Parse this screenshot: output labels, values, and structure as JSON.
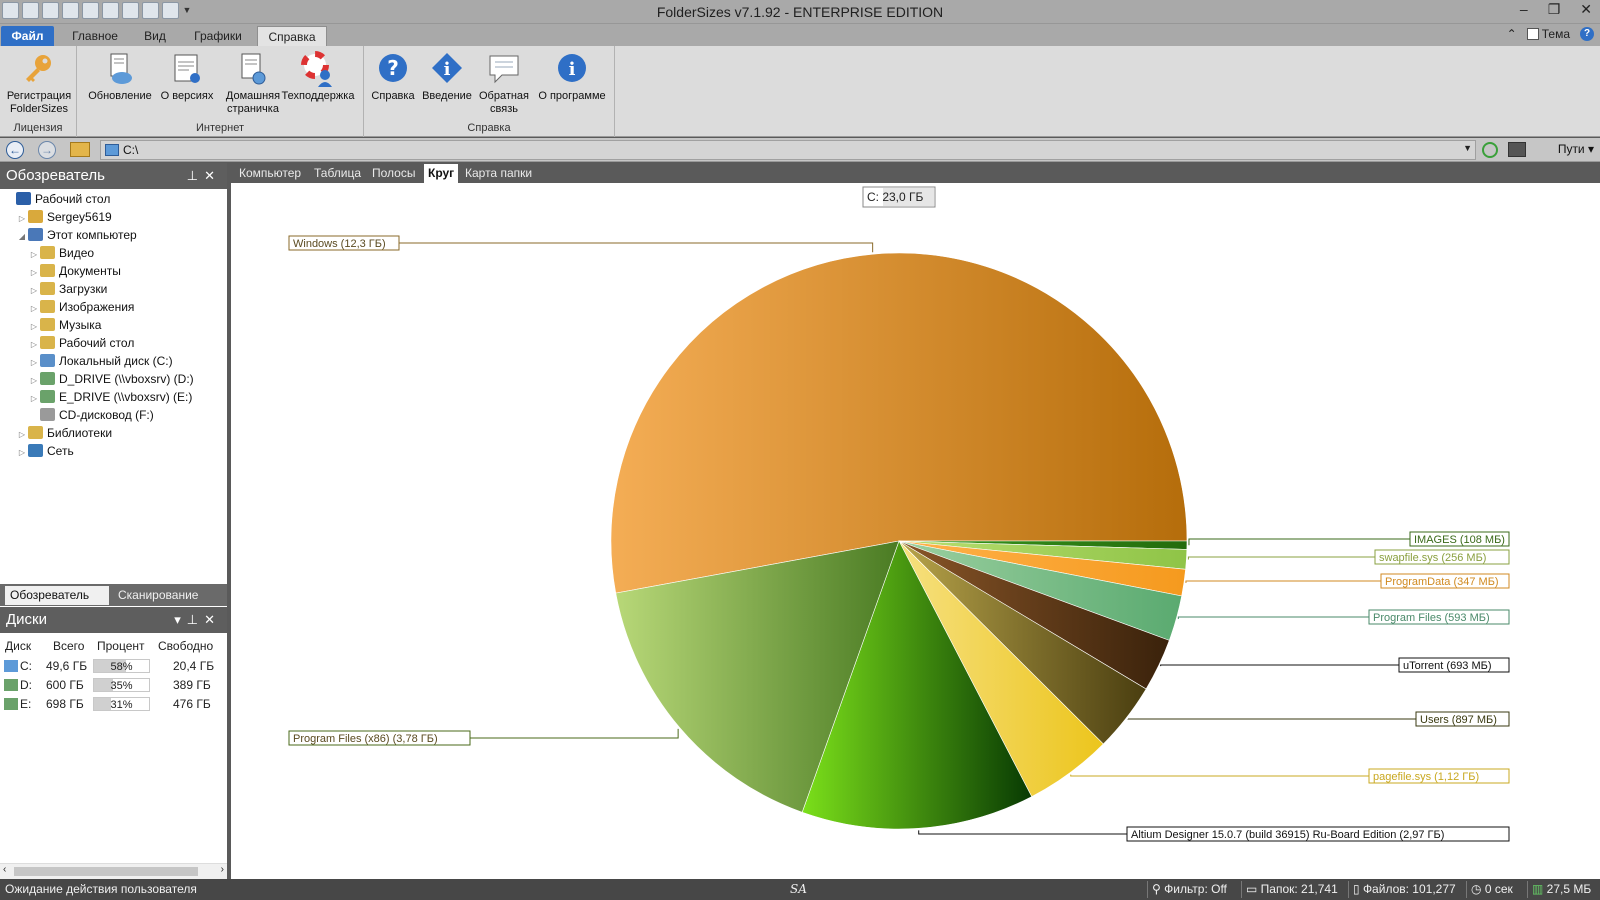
{
  "app_title": "FolderSizes v7.1.92 - ENTERPRISE EDITION",
  "quick_access_icons": [
    "new-icon",
    "open-icon",
    "save-icon",
    "search-icon",
    "refresh-icon",
    "folder-icon",
    "floppy-icon",
    "copy-icon",
    "print-icon"
  ],
  "window_controls": {
    "minimize": "–",
    "restore": "❐",
    "close": "✕"
  },
  "ribbon_tabs": {
    "file": "Файл",
    "main": "Главное",
    "view": "Вид",
    "graphs": "Графики",
    "help": "Справка"
  },
  "ribbon_right": {
    "theme": "Тема",
    "help": "?",
    "collapse": "⌃"
  },
  "ribbon": {
    "group_license": "Лицензия",
    "group_internet": "Интернет",
    "group_help": "Справка",
    "btn_register": "Регистрация FolderSizes",
    "btn_update": "Обновление",
    "btn_versions": "О версиях",
    "btn_home": "Домашняя страничка",
    "btn_support": "Техподдержка",
    "btn_help": "Справка",
    "btn_intro": "Введение",
    "btn_feedback": "Обратная связь",
    "btn_about": "О программе"
  },
  "address": {
    "path": "C:\\",
    "paths_button": "Пути"
  },
  "explorer": {
    "title": "Обозреватель",
    "tree": [
      {
        "label": "Рабочий стол",
        "level": 0,
        "arrow": "",
        "icon": "desktop-icon",
        "color": "#2b5fa8"
      },
      {
        "label": "Sergey5619",
        "level": 1,
        "arrow": "▷",
        "icon": "user-folder-icon",
        "color": "#d9a93c"
      },
      {
        "label": "Этот компьютер",
        "level": 1,
        "arrow": "◢",
        "icon": "computer-icon",
        "color": "#4a78b8"
      },
      {
        "label": "Видео",
        "level": 2,
        "arrow": "▷",
        "icon": "video-folder-icon",
        "color": "#d9b44a"
      },
      {
        "label": "Документы",
        "level": 2,
        "arrow": "▷",
        "icon": "documents-folder-icon",
        "color": "#d9b44a"
      },
      {
        "label": "Загрузки",
        "level": 2,
        "arrow": "▷",
        "icon": "downloads-folder-icon",
        "color": "#d9b44a"
      },
      {
        "label": "Изображения",
        "level": 2,
        "arrow": "▷",
        "icon": "pictures-folder-icon",
        "color": "#d9b44a"
      },
      {
        "label": "Музыка",
        "level": 2,
        "arrow": "▷",
        "icon": "music-folder-icon",
        "color": "#d9b44a"
      },
      {
        "label": "Рабочий стол",
        "level": 2,
        "arrow": "▷",
        "icon": "desktop-folder-icon",
        "color": "#d9b44a"
      },
      {
        "label": "Локальный диск (C:)",
        "level": 2,
        "arrow": "▷",
        "icon": "local-disk-icon",
        "color": "#5a8fc9"
      },
      {
        "label": "D_DRIVE (\\\\vboxsrv) (D:)",
        "level": 2,
        "arrow": "▷",
        "icon": "network-drive-icon",
        "color": "#6aa26a"
      },
      {
        "label": "E_DRIVE (\\\\vboxsrv) (E:)",
        "level": 2,
        "arrow": "▷",
        "icon": "network-drive-icon",
        "color": "#6aa26a"
      },
      {
        "label": "CD-дисковод (F:)",
        "level": 2,
        "arrow": "",
        "icon": "cd-drive-icon",
        "color": "#9a9a9a"
      },
      {
        "label": "Библиотеки",
        "level": 1,
        "arrow": "▷",
        "icon": "libraries-icon",
        "color": "#d9b44a"
      },
      {
        "label": "Сеть",
        "level": 1,
        "arrow": "▷",
        "icon": "network-icon",
        "color": "#3a7ab8"
      }
    ],
    "tab_explorer": "Обозреватель",
    "tab_scan": "Сканирование"
  },
  "disks": {
    "title": "Диски",
    "columns": [
      "Диск",
      "Всего",
      "Процент",
      "Свободно"
    ],
    "rows": [
      {
        "disk": "C:",
        "total": "49,6 ГБ",
        "percent": "58%",
        "percent_value": 58,
        "free": "20,4 ГБ"
      },
      {
        "disk": "D:",
        "total": "600 ГБ",
        "percent": "35%",
        "percent_value": 35,
        "free": "389 ГБ"
      },
      {
        "disk": "E:",
        "total": "698 ГБ",
        "percent": "31%",
        "percent_value": 31,
        "free": "476 ГБ"
      }
    ]
  },
  "view_tabs": [
    "Компьютер",
    "Таблица",
    "Полосы",
    "Круг",
    "Карта папки"
  ],
  "active_view_tab": "Круг",
  "chart_data": {
    "type": "pie",
    "title": "C:  23,0 ГБ",
    "slices": [
      {
        "label": "Windows (12,3 ГБ)",
        "value": 12300,
        "color_light": "#f4ad55",
        "color_dark": "#b56d0b"
      },
      {
        "label": "IMAGES (108 МБ)",
        "value": 108,
        "color_light": "#3a9a20",
        "color_dark": "#246c0c"
      },
      {
        "label": "swapfile.sys (256 МБ)",
        "value": 256,
        "color_light": "#b8de70",
        "color_dark": "#8fc447"
      },
      {
        "label": "ProgramData (347 МБ)",
        "value": 347,
        "color_light": "#ffb14a",
        "color_dark": "#f59a1e"
      },
      {
        "label": "Program Files (593 МБ)",
        "value": 593,
        "color_light": "#9cd0a0",
        "color_dark": "#5aaa70"
      },
      {
        "label": "uTorrent (693 МБ)",
        "value": 693,
        "color_light": "#8a5628",
        "color_dark": "#3a220b"
      },
      {
        "label": "Users (897 МБ)",
        "value": 897,
        "color_light": "#b8a44a",
        "color_dark": "#4a3e10"
      },
      {
        "label": "pagefile.sys (1,12 ГБ)",
        "value": 1147,
        "color_light": "#f6e080",
        "color_dark": "#ecc51c"
      },
      {
        "label": "Altium Designer 15.0.7 (build 36915) Ru-Board Edition (2,97 ГБ)",
        "value": 3041,
        "color_light": "#7be01a",
        "color_dark": "#083a03"
      },
      {
        "label": "Program Files (x86) (3,78 ГБ)",
        "value": 3871,
        "color_light": "#b8d878",
        "color_dark": "#4a7b23"
      }
    ]
  },
  "status": {
    "message": "Ожидание действия пользователя",
    "center": "SA",
    "filter": "Фильтр: Off",
    "folders": "Папок: 21,741",
    "files": "Файлов: 101,277",
    "time": "0 сек",
    "memory": "27,5 МБ"
  }
}
